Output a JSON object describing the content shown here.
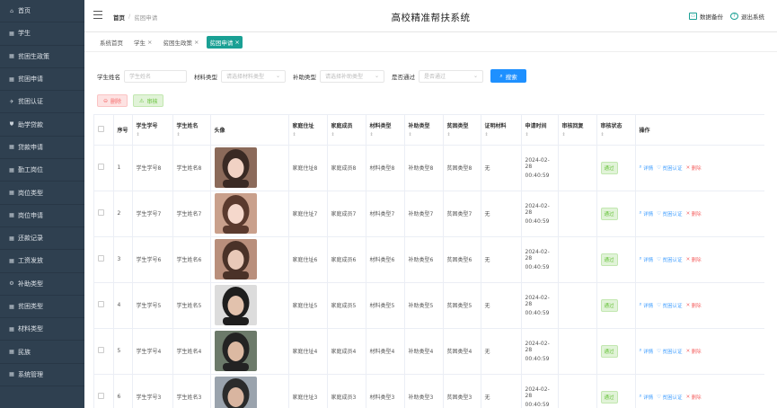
{
  "sidebar": {
    "items": [
      {
        "label": "首页",
        "icon": "home-icon"
      },
      {
        "label": "学生",
        "icon": "grid-icon"
      },
      {
        "label": "贫困生政策",
        "icon": "grid-icon"
      },
      {
        "label": "贫困申请",
        "icon": "grid-icon"
      },
      {
        "label": "贫困认证",
        "icon": "plane-icon"
      },
      {
        "label": "助学贷款",
        "icon": "shield-icon"
      },
      {
        "label": "贷款申请",
        "icon": "grid-icon"
      },
      {
        "label": "勤工岗位",
        "icon": "grid-icon"
      },
      {
        "label": "岗位类型",
        "icon": "grid-icon"
      },
      {
        "label": "岗位申请",
        "icon": "grid-icon"
      },
      {
        "label": "还款记录",
        "icon": "grid-icon"
      },
      {
        "label": "工资发放",
        "icon": "grid-icon"
      },
      {
        "label": "补助类型",
        "icon": "gear-icon"
      },
      {
        "label": "贫困类型",
        "icon": "grid-icon"
      },
      {
        "label": "材料类型",
        "icon": "grid-icon"
      },
      {
        "label": "民族",
        "icon": "grid-icon"
      },
      {
        "label": "系统管理",
        "icon": "grid-icon"
      }
    ]
  },
  "header": {
    "breadcrumb_home": "首页",
    "breadcrumb_current": "贫困申请",
    "title": "高校精准帮扶系统",
    "backup_label": "数据备份",
    "logout_label": "退出系统"
  },
  "tags": [
    {
      "label": "系统首页",
      "closable": false,
      "active": false
    },
    {
      "label": "学生",
      "closable": true,
      "active": false
    },
    {
      "label": "贫困生政策",
      "closable": true,
      "active": false
    },
    {
      "label": "贫困申请",
      "closable": true,
      "active": true
    }
  ],
  "search": {
    "student_name_label": "学生姓名",
    "student_name_placeholder": "学生姓名",
    "material_label": "材料类型",
    "material_placeholder": "请选择材料类型",
    "subsidy_label": "补助类型",
    "subsidy_placeholder": "请选择补助类型",
    "passed_label": "是否通过",
    "passed_placeholder": "是否通过",
    "search_button": "搜索"
  },
  "actions": {
    "delete_label": "删除",
    "audit_label": "审核"
  },
  "table": {
    "headers": [
      "序号",
      "学生学号",
      "学生姓名",
      "头像",
      "家庭住址",
      "家庭成员",
      "材料类型",
      "补助类型",
      "贫困类型",
      "证明材料",
      "申请时间",
      "审核回复",
      "审核状态",
      "操作"
    ],
    "sort_glyph": "⇕",
    "rows": [
      {
        "index": "1",
        "sid": "学生学号8",
        "name": "学生姓名8",
        "address": "家庭住址8",
        "members": "家庭成员8",
        "material": "材料类型8",
        "subsidy": "补助类型8",
        "poverty": "贫困类型8",
        "proof": "无",
        "date": "2024-02-28",
        "time": "00:40:59",
        "reply": "",
        "status": "通过"
      },
      {
        "index": "2",
        "sid": "学生学号7",
        "name": "学生姓名7",
        "address": "家庭住址7",
        "members": "家庭成员7",
        "material": "材料类型7",
        "subsidy": "补助类型7",
        "poverty": "贫困类型7",
        "proof": "无",
        "date": "2024-02-28",
        "time": "00:40:59",
        "reply": "",
        "status": "通过"
      },
      {
        "index": "3",
        "sid": "学生学号6",
        "name": "学生姓名6",
        "address": "家庭住址6",
        "members": "家庭成员6",
        "material": "材料类型6",
        "subsidy": "补助类型6",
        "poverty": "贫困类型6",
        "proof": "无",
        "date": "2024-02-28",
        "time": "00:40:59",
        "reply": "",
        "status": "通过"
      },
      {
        "index": "4",
        "sid": "学生学号5",
        "name": "学生姓名5",
        "address": "家庭住址5",
        "members": "家庭成员5",
        "material": "材料类型5",
        "subsidy": "补助类型5",
        "poverty": "贫困类型5",
        "proof": "无",
        "date": "2024-02-28",
        "time": "00:40:59",
        "reply": "",
        "status": "通过"
      },
      {
        "index": "5",
        "sid": "学生学号4",
        "name": "学生姓名4",
        "address": "家庭住址4",
        "members": "家庭成员4",
        "material": "材料类型4",
        "subsidy": "补助类型4",
        "poverty": "贫困类型4",
        "proof": "无",
        "date": "2024-02-28",
        "time": "00:40:59",
        "reply": "",
        "status": "通过"
      },
      {
        "index": "6",
        "sid": "学生学号3",
        "name": "学生姓名3",
        "address": "家庭住址3",
        "members": "家庭成员3",
        "material": "材料类型3",
        "subsidy": "补助类型3",
        "poverty": "贫困类型3",
        "proof": "无",
        "date": "2024-02-28",
        "time": "00:40:59",
        "reply": "",
        "status": "通过"
      }
    ],
    "op_detail": "详情",
    "op_cert": "贫困认证",
    "op_delete": "删除"
  },
  "colors": {
    "sidebar_bg": "#2f4050",
    "accent": "#1aa094",
    "primary": "#1e90ff",
    "danger": "#f56c6c",
    "success": "#67c23a"
  }
}
